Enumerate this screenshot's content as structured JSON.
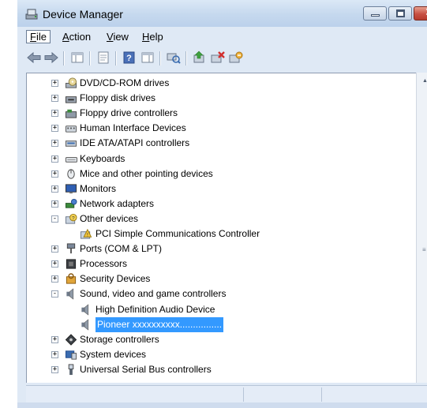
{
  "window": {
    "title": "Device Manager",
    "controls": {
      "minimize": "minimize",
      "maximize": "maximize",
      "close": "close"
    }
  },
  "menu": [
    {
      "name": "menu-file",
      "label": "File",
      "accel": "F"
    },
    {
      "name": "menu-action",
      "label": "Action",
      "accel": "A"
    },
    {
      "name": "menu-view",
      "label": "View",
      "accel": "V"
    },
    {
      "name": "menu-help",
      "label": "Help",
      "accel": "H"
    }
  ],
  "toolbar": [
    {
      "icon": "back-arrow-icon"
    },
    {
      "icon": "forward-arrow-icon"
    },
    {
      "icon": "show-hide-console-tree-icon"
    },
    {
      "icon": "properties-icon"
    },
    {
      "icon": "help-icon"
    },
    {
      "icon": "action-pane-icon"
    },
    {
      "icon": "scan-hardware-icon"
    },
    {
      "icon": "update-driver-icon"
    },
    {
      "icon": "uninstall-icon"
    },
    {
      "icon": "disable-device-icon"
    }
  ],
  "tree": [
    {
      "label": "DVD/CD-ROM drives",
      "level": 1,
      "expander": "+",
      "icon": "dvd-drive-icon"
    },
    {
      "label": "Floppy disk drives",
      "level": 1,
      "expander": "+",
      "icon": "floppy-drive-icon"
    },
    {
      "label": "Floppy drive controllers",
      "level": 1,
      "expander": "+",
      "icon": "floppy-controller-icon"
    },
    {
      "label": "Human Interface Devices",
      "level": 1,
      "expander": "+",
      "icon": "hid-icon"
    },
    {
      "label": "IDE ATA/ATAPI controllers",
      "level": 1,
      "expander": "+",
      "icon": "ide-controller-icon"
    },
    {
      "label": "Keyboards",
      "level": 1,
      "expander": "+",
      "icon": "keyboard-icon"
    },
    {
      "label": "Mice and other pointing devices",
      "level": 1,
      "expander": "+",
      "icon": "mouse-icon"
    },
    {
      "label": "Monitors",
      "level": 1,
      "expander": "+",
      "icon": "monitor-icon"
    },
    {
      "label": "Network adapters",
      "level": 1,
      "expander": "+",
      "icon": "network-adapter-icon"
    },
    {
      "label": "Other devices",
      "level": 1,
      "expander": "-",
      "icon": "unknown-device-icon"
    },
    {
      "label": "PCI Simple Communications Controller",
      "level": 2,
      "expander": "",
      "icon": "warning-device-icon"
    },
    {
      "label": "Ports (COM & LPT)",
      "level": 1,
      "expander": "+",
      "icon": "port-icon"
    },
    {
      "label": "Processors",
      "level": 1,
      "expander": "+",
      "icon": "processor-icon"
    },
    {
      "label": "Security Devices",
      "level": 1,
      "expander": "+",
      "icon": "security-device-icon"
    },
    {
      "label": "Sound, video and game controllers",
      "level": 1,
      "expander": "-",
      "icon": "speaker-icon"
    },
    {
      "label": "High Definition Audio Device",
      "level": 2,
      "expander": "",
      "icon": "speaker-icon"
    },
    {
      "label": "Pioneer xxxxxxxxxx................",
      "level": 2,
      "expander": "",
      "icon": "speaker-icon",
      "selected": true
    },
    {
      "label": "Storage controllers",
      "level": 1,
      "expander": "+",
      "icon": "storage-controller-icon"
    },
    {
      "label": "System devices",
      "level": 1,
      "expander": "+",
      "icon": "system-device-icon"
    },
    {
      "label": "Universal Serial Bus controllers",
      "level": 1,
      "expander": "+",
      "icon": "usb-icon"
    }
  ],
  "colors": {
    "selection": "#3399ff",
    "titlebar": "#c5d8ee",
    "close_button": "#c75043"
  }
}
